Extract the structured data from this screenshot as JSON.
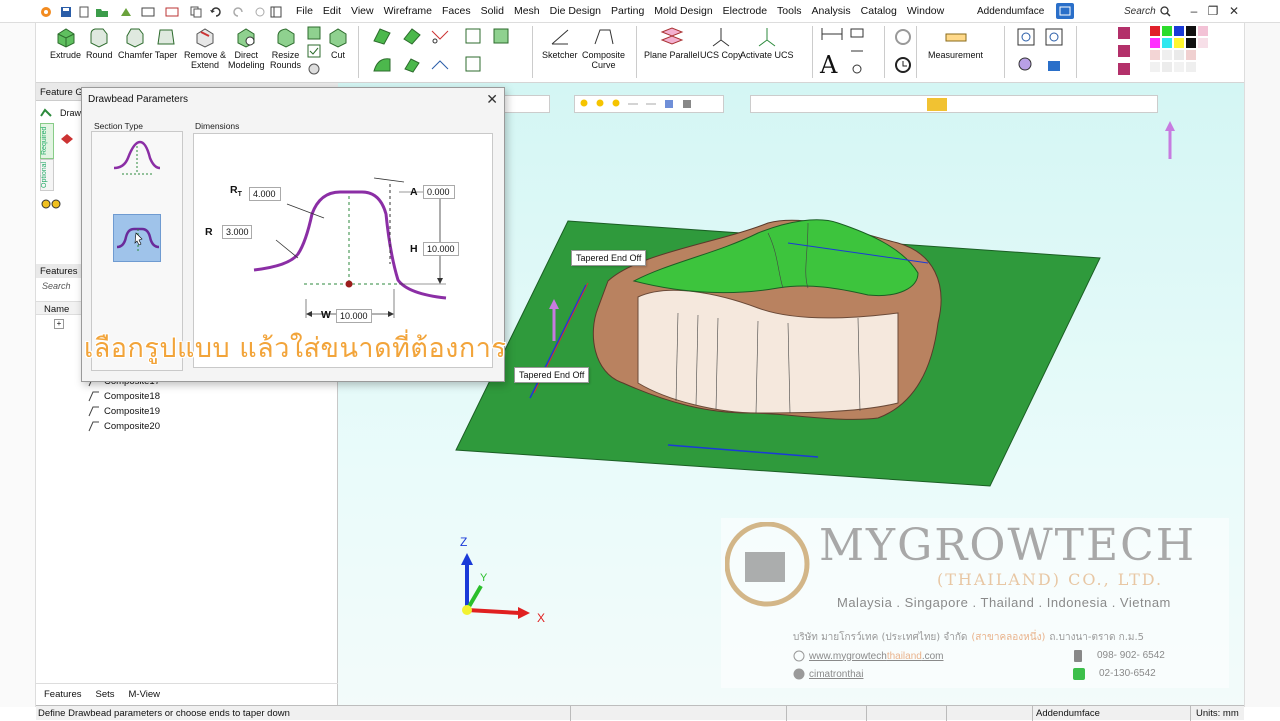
{
  "menu": {
    "items": [
      "File",
      "Edit",
      "View",
      "Wireframe",
      "Faces",
      "Solid",
      "Mesh",
      "Die Design",
      "Parting",
      "Mold Design",
      "Electrode",
      "Tools",
      "Analysis",
      "Catalog",
      "Window"
    ],
    "app_title": "Addendumface",
    "search_placeholder": "Search"
  },
  "ribbon": {
    "extrude": "Extrude",
    "round": "Round",
    "chamfer": "Chamfer",
    "taper": "Taper",
    "remove_extend": "Remove &\nExtend",
    "direct_modeling": "Direct\nModeling",
    "resize_rounds": "Resize\nRounds",
    "cut": "Cut",
    "sketcher": "Sketcher",
    "composite_curve": "Composite\nCurve",
    "plane_parallel": "Plane Parallel",
    "ucs_copy": "UCS Copy",
    "activate_ucs": "Activate UCS",
    "measurement": "Measurement"
  },
  "left_panel": {
    "feature_guide_title": "Feature G",
    "feature_guide_item": "Draw",
    "tab_required": "Required",
    "tab_optional": "Optional",
    "features_header": "Features",
    "search_placeholder": "Search",
    "name_column": "Name",
    "tree_items": [
      "Composite17",
      "Composite18",
      "Composite19",
      "Composite20"
    ],
    "bottom_tabs": [
      "Features",
      "Sets",
      "M-View"
    ]
  },
  "dialog": {
    "title": "Drawbead Parameters",
    "section_type_label": "Section Type",
    "dimensions_label": "Dimensions",
    "rt_label": "R",
    "rt_sub": "T",
    "rt_value": "4.000",
    "r_label": "R",
    "r_value": "3.000",
    "a_label": "A",
    "a_value": "0.000",
    "h_label": "H",
    "h_value": "10.000",
    "w_label": "W",
    "w_value": "10.000"
  },
  "overlay_caption": "เลือกรูปแบบ  แล้วใส่ขนาดที่ต้องการ",
  "viewport": {
    "tag_top": "Tapered End Off",
    "tag_bottom": "Tapered End Off",
    "axis_x": "X",
    "axis_y": "Y",
    "axis_z": "Z"
  },
  "watermark": {
    "company": "MYGROWTECH",
    "sub": "(THAILAND) CO., LTD.",
    "countries": "Malaysia . Singapore . Thailand . Indonesia . Vietnam",
    "thai_name": "บริษัท มายโกรว์เทค (ประเทศไทย) จำกัด",
    "thai_branch": "(สาขาคลองหนึ่ง)",
    "thai_address": "ถ.บางนา-ตราด ก.ม.5",
    "website_main": "www.mygrowtech",
    "website_suffix": "thailand",
    "website_end": ".com",
    "facebook": "cimatronthai",
    "phone": "098- 902- 6542",
    "line": "02-130-6542"
  },
  "status": {
    "message": "Define Drawbead parameters or choose ends to taper down",
    "document": "Addendumface",
    "units": "Units: mm"
  },
  "colors": {
    "accent_purple": "#8b2ea5",
    "surface_green": "#2f9a3c",
    "caption_orange": "#f2a43a"
  }
}
